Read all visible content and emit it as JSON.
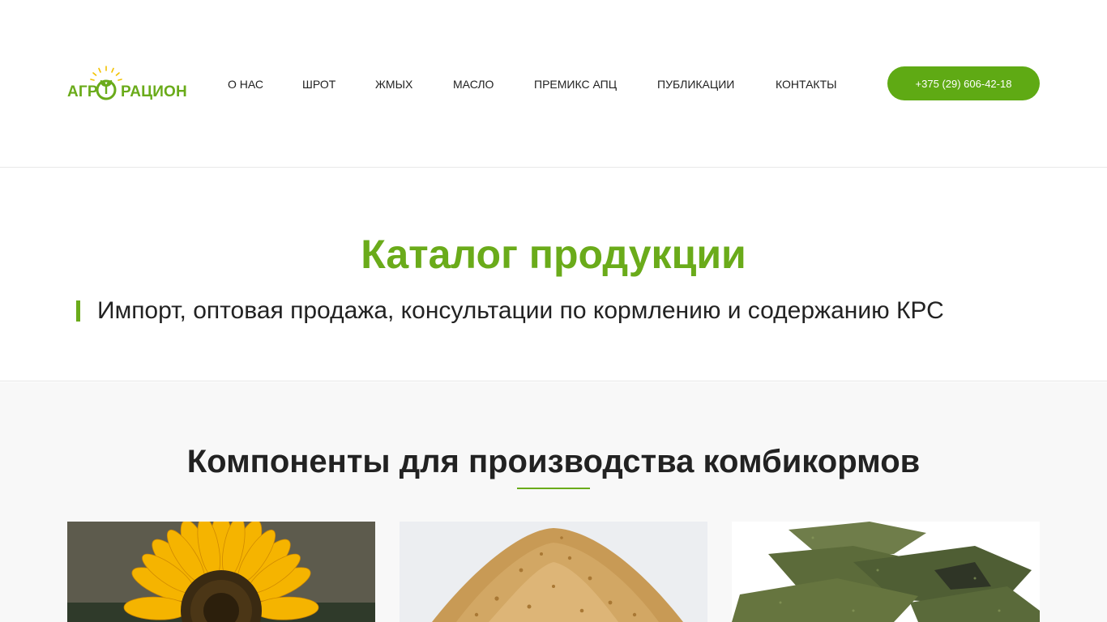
{
  "header": {
    "logo": {
      "text_left": "АГР",
      "text_right": "РАЦИОН"
    },
    "nav": [
      {
        "label": "О НАС"
      },
      {
        "label": "ШРОТ"
      },
      {
        "label": "ЖМЫХ"
      },
      {
        "label": "МАСЛО"
      },
      {
        "label": "ПРЕМИКС АПЦ"
      },
      {
        "label": "ПУБЛИКАЦИИ"
      },
      {
        "label": "КОНТАКТЫ"
      }
    ],
    "phone": "+375 (29) 606-42-18"
  },
  "catalog": {
    "title": "Каталог продукции",
    "subtitle": "Импорт, оптовая продажа, консультации по кормлению и содержанию КРС"
  },
  "components": {
    "title": "Компоненты для производства комбикормов",
    "cards": [
      {
        "image": "sunflower-photo"
      },
      {
        "image": "soybean-meal-photo"
      },
      {
        "image": "oilcake-photo"
      }
    ]
  },
  "colors": {
    "accent": "#6aab1a",
    "button": "#5faa14",
    "text": "#222222",
    "section_bg": "#f8f8f8"
  }
}
